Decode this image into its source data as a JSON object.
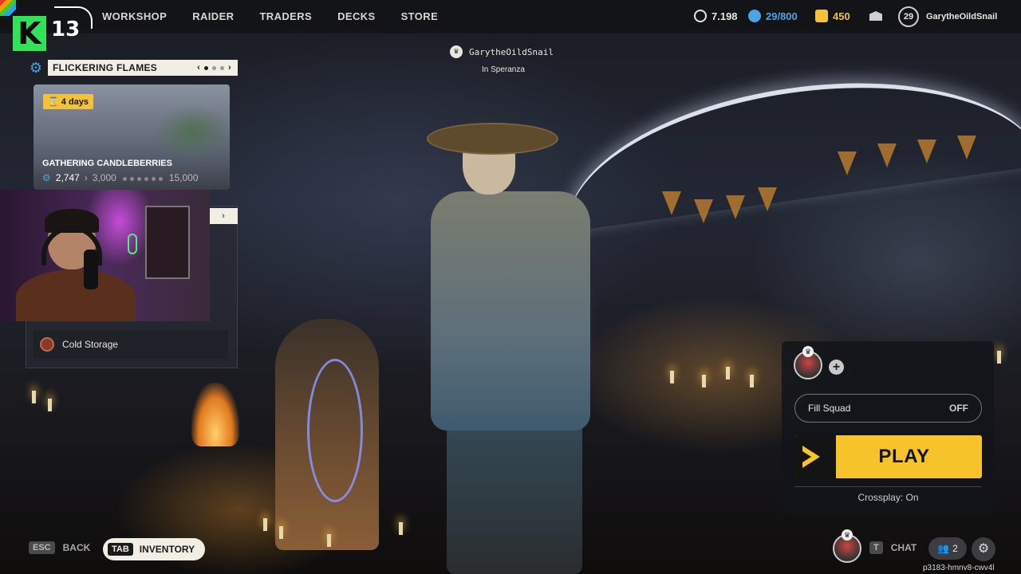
{
  "brand": {
    "logo_letter": "K",
    "logo_number": "13"
  },
  "nav": {
    "items": [
      "WORKSHOP",
      "RAIDER",
      "TRADERS",
      "DECKS",
      "STORE"
    ]
  },
  "currencies": [
    {
      "icon": "coin-icon",
      "value": "7.198",
      "color": "#e8e6e0"
    },
    {
      "icon": "blue-token-icon",
      "value": "29/800",
      "color": "#4aa6e0"
    },
    {
      "icon": "gold-coins-icon",
      "value": "450",
      "color": "#f2c23a"
    }
  ],
  "profile": {
    "level": "29",
    "name": "GarytheOildSnail"
  },
  "player_tag": {
    "name": "GarytheOildSnail",
    "location": "In Speranza"
  },
  "event": {
    "title": "FLICKERING FLAMES",
    "nav_prev": "‹",
    "nav_next": "›",
    "days_badge": "4 days",
    "card_title": "GATHERING CANDLEBERRIES",
    "current": "2,747",
    "next_goal": "3,000",
    "final_goal": "15,000"
  },
  "panel2": {
    "tab_symbol": "›",
    "item_label": "Cold Storage"
  },
  "squad": {
    "fill_label": "Fill Squad",
    "fill_state": "OFF",
    "play_label": "PLAY",
    "crossplay": "Crossplay: On",
    "add_symbol": "+"
  },
  "bottom": {
    "back_key": "ESC",
    "back_label": "BACK",
    "inventory_key": "TAB",
    "inventory_label": "INVENTORY",
    "chat_key": "T",
    "chat_label": "CHAT",
    "friends_count": "2",
    "session_id": "p3183-hmnv8-cwv4l"
  },
  "colors": {
    "accent_yellow": "#f6c32a",
    "brand_green": "#32e35a",
    "accent_blue": "#4aa6e0"
  }
}
